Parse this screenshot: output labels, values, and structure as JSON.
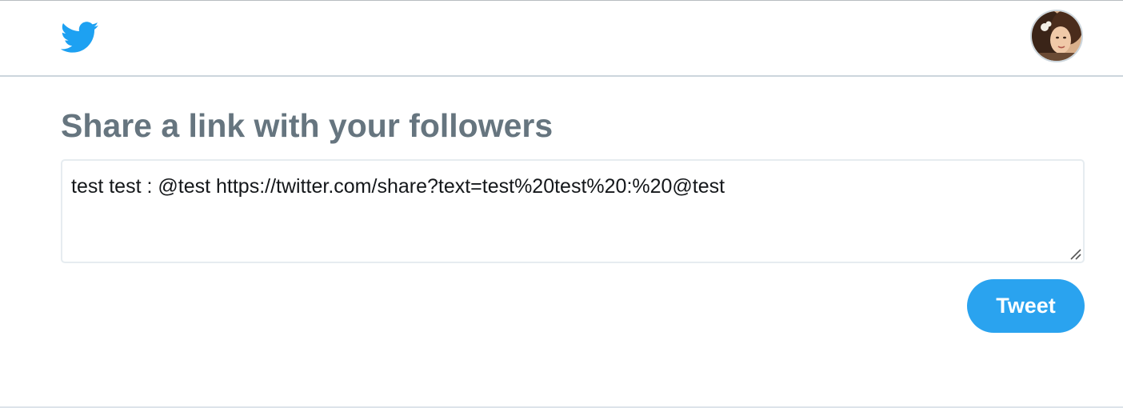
{
  "header": {
    "logo_icon": "twitter-bird-icon",
    "avatar_icon": "user-avatar"
  },
  "main": {
    "title": "Share a link with your followers",
    "composer": {
      "value": "test test : @test https://twitter.com/share?text=test%20test%20:%20@test"
    },
    "tweet_button_label": "Tweet"
  },
  "colors": {
    "brand_blue": "#1da1f2",
    "button_blue": "#2aa3ef",
    "title_gray": "#66757f",
    "border": "#e6ecf0"
  }
}
